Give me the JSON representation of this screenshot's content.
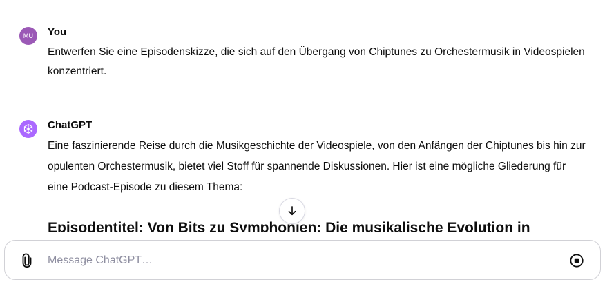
{
  "conversation": {
    "user_message": {
      "avatar_initials": "MU",
      "author": "You",
      "text": "Entwerfen Sie eine Episodenskizze, die sich auf den Übergang von Chiptunes zu Orchestermusik in Videospielen konzentriert."
    },
    "assistant_message": {
      "author": "ChatGPT",
      "text": "Eine faszinierende Reise durch die Musikgeschichte der Videospiele, von den Anfängen der Chiptunes bis hin zur opulenten Orchestermusik, bietet viel Stoff für spannende Diskussionen. Hier ist eine mögliche Gliederung für eine Podcast-Episode zu diesem Thema:",
      "heading": "Episodentitel: Von Bits zu Symphonien: Die musikalische Evolution in"
    }
  },
  "composer": {
    "placeholder": "Message ChatGPT…"
  },
  "icons": {
    "user_avatar": "avatar",
    "assistant_avatar": "openai-logo-icon",
    "scroll": "arrow-down-icon",
    "attach": "paperclip-icon",
    "stop": "stop-icon"
  },
  "colors": {
    "user_avatar_bg": "#9b59b6",
    "assistant_avatar_bg": "#ab68ff",
    "text": "#0d0d0d",
    "placeholder": "#8e8ea0",
    "border": "#d1d1d6"
  }
}
